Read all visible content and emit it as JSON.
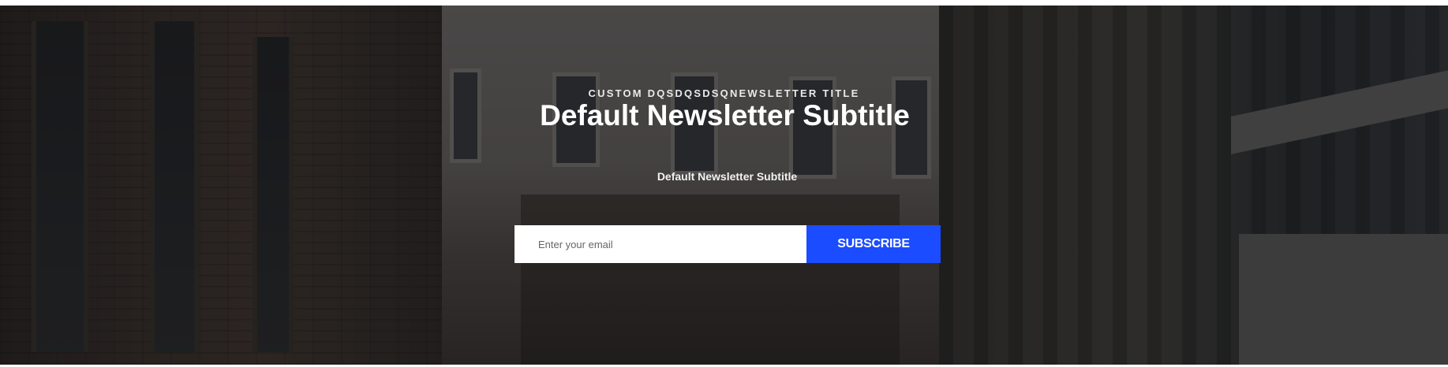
{
  "newsletter": {
    "eyebrow": "CUSTOM DQSDQSDSQNEWSLETTER TITLE",
    "title": "Default Newsletter Subtitle",
    "subtitle": "Default Newsletter Subtitle",
    "email_placeholder": "Enter your email",
    "email_value": "",
    "subscribe_label": "SUBSCRIBE"
  },
  "colors": {
    "accent": "#1c4cff",
    "overlay": "rgba(20,20,22,0.55)",
    "text": "#ffffff"
  }
}
